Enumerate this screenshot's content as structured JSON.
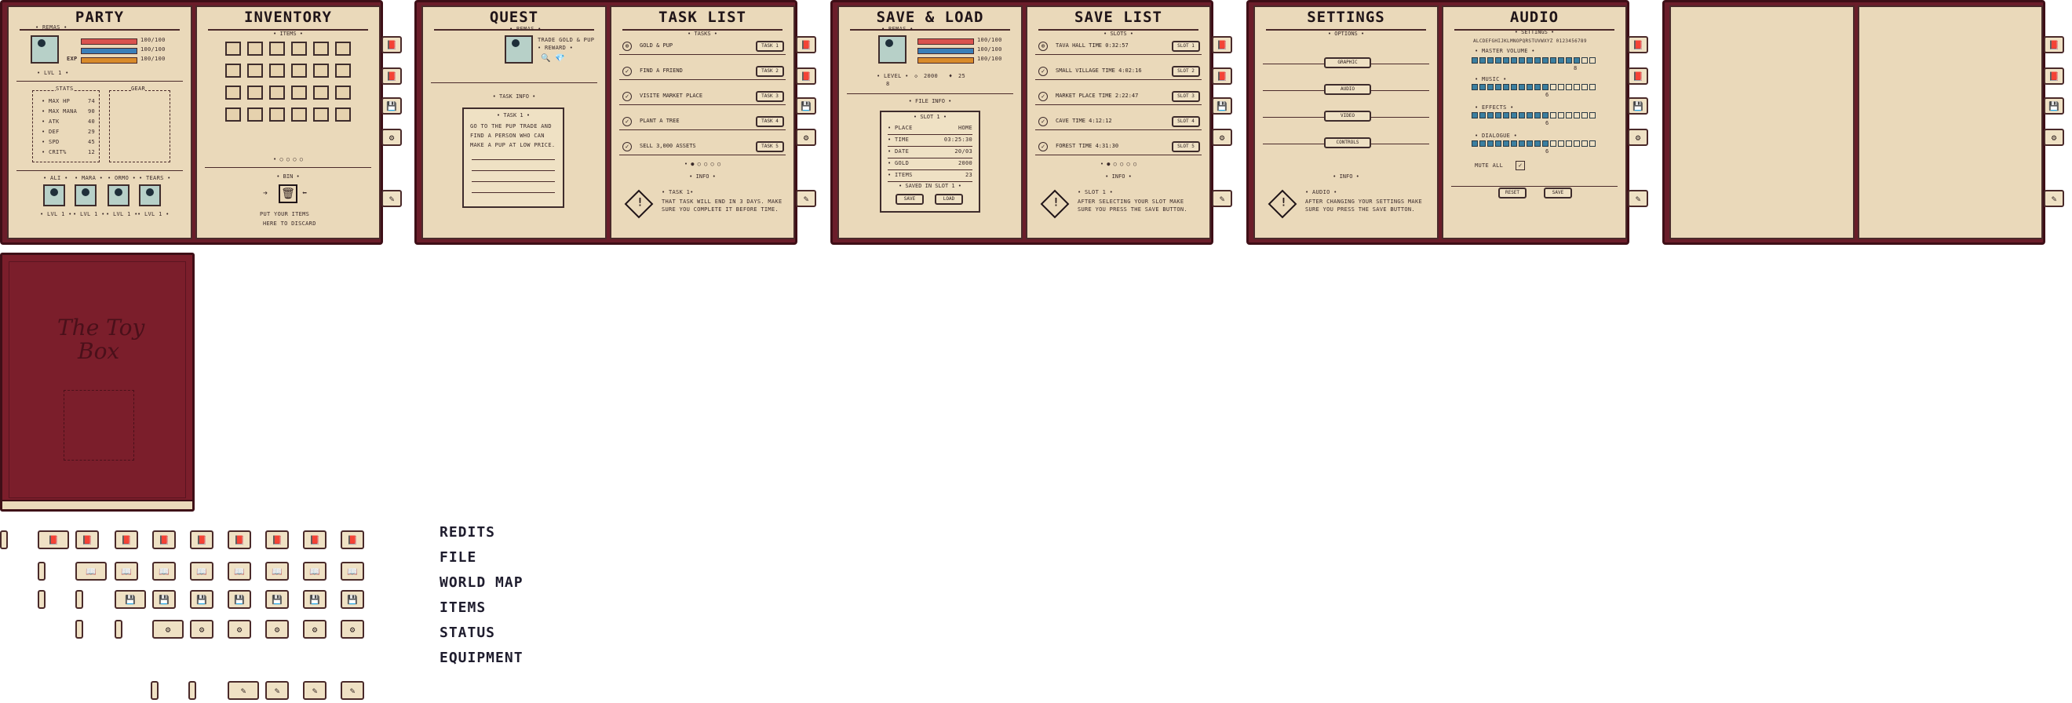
{
  "books": {
    "party": {
      "title": "PARTY",
      "hero_name": "• REMAS •",
      "hp_text": "100/100",
      "mp_text": "100/100",
      "exp_label": "EXP",
      "exp_text": "100/100",
      "level": "• LVL 1 •",
      "stats_header": "STATS",
      "gear_header": "GEAR",
      "stats": [
        {
          "k": "• MAX HP",
          "v": "74"
        },
        {
          "k": "• MAX MANA",
          "v": "90"
        },
        {
          "k": "• ATK",
          "v": "40"
        },
        {
          "k": "• DEF",
          "v": "29"
        },
        {
          "k": "• SPD",
          "v": "45"
        },
        {
          "k": "• CRIT%",
          "v": "12"
        }
      ],
      "members": [
        "• ALI •",
        "• MARA •",
        "• ORMO •",
        "• TEARS •"
      ],
      "member_levels": [
        "• LVL 1 •",
        "• LVL 1 •",
        "• LVL 1 •",
        "• LVL 1 •"
      ]
    },
    "inventory": {
      "title": "INVENTORY",
      "items_header": "• ITEMS •",
      "bin_header": "• BIN •",
      "bin_hint_1": "PUT YOUR ITEMS",
      "bin_hint_2": "HERE TO DISCARD",
      "dots": "• ○ ○ ○ ○"
    },
    "quest": {
      "title": "QUEST",
      "hero_name": "• REMAS •",
      "goal": "TRADE GOLD & PUP",
      "reward_label": "• REWARD •",
      "task_info_header": "• TASK INFO •",
      "task_num": "• TASK 1 •",
      "task_lines": [
        "GO TO THE PUP TRADE AND",
        "FIND A PERSON WHO CAN",
        "MAKE A PUP AT LOW PRICE."
      ]
    },
    "task_list": {
      "title": "TASK LIST",
      "header": "• TASKS •",
      "tasks": [
        {
          "text": "GOLD & PUP",
          "btn": "TASK 1"
        },
        {
          "text": "FIND A FRIEND",
          "btn": "TASK 2"
        },
        {
          "text": "VISITE MARKET PLACE",
          "btn": "TASK 3"
        },
        {
          "text": "PLANT A TREE",
          "btn": "TASK 4"
        },
        {
          "text": "SELL 3,000 ASSETS",
          "btn": "TASK 5"
        }
      ],
      "dots": "• ● ○ ○ ○ ○",
      "info_header": "• INFO •",
      "info_title": "• TASK 1•",
      "info_lines": [
        "THAT TASK WILL END IN 3 DAYS. MAKE",
        "SURE YOU COMPLETE IT BEFORE TIME."
      ]
    },
    "save_load": {
      "title": "SAVE & LOAD",
      "hero_name": "• REMAS •",
      "hp_text": "100/100",
      "mp_text": "100/100",
      "exp_text": "100/100",
      "level_label": "• LEVEL •",
      "gold": "2000",
      "gems": "25",
      "level": "8",
      "file_info_header": "• FILE INFO •",
      "slot_header": "• SLOT 1 •",
      "fields": [
        {
          "k": "• PLACE",
          "v": "HOME"
        },
        {
          "k": "• TIME",
          "v": "03:25:30"
        },
        {
          "k": "• DATE",
          "v": "20/03"
        },
        {
          "k": "• GOLD",
          "v": "2000"
        },
        {
          "k": "• ITEMS",
          "v": "23"
        }
      ],
      "saved_label": "• SAVED IN SLOT 1 •",
      "save_btn": "SAVE",
      "load_btn": "LOAD"
    },
    "save_list": {
      "title": "SAVE LIST",
      "header": "• SLOTS •",
      "slots": [
        {
          "text": "TAVA HALL TIME 0:32:57",
          "btn": "SLOT 1"
        },
        {
          "text": "SMALL VILLAGE TIME 4:02:16",
          "btn": "SLOT 2"
        },
        {
          "text": "MARKET PLACE TIME 2:22:47",
          "btn": "SLOT 3"
        },
        {
          "text": "CAVE TIME 4:12:12",
          "btn": "SLOT 4"
        },
        {
          "text": "FOREST TIME 4:31:30",
          "btn": "SLOT 5"
        }
      ],
      "dots": "• ● ○ ○ ○ ○",
      "info_header": "• INFO •",
      "info_title": "• SLOT 1 •",
      "info_lines": [
        "AFTER SELECTING YOUR SLOT MAKE",
        "SURE YOU PRESS THE SAVE BUTTON."
      ]
    },
    "settings": {
      "title": "SETTINGS",
      "header": "• OPTIONS •",
      "options": [
        "GRAPHIC",
        "AUDIO",
        "VIDEO",
        "CONTROLS"
      ],
      "info_header": "• INFO •",
      "info_title": "• AUDIO •",
      "info_lines": [
        "AFTER CHANGING YOUR SETTINGS MAKE",
        "SURE YOU PRESS THE SAVE BUTTON."
      ]
    },
    "audio": {
      "title": "AUDIO",
      "header": "• SETTINGS •",
      "scale": "ALCDEFGHIJKLMNOPQRSTUVWXYZ 0123456789",
      "sliders": [
        {
          "label": "• MASTER VOLUME •",
          "level": 0.85,
          "value": "8"
        },
        {
          "label": "• MUSIC •",
          "level": 0.6,
          "value": "6"
        },
        {
          "label": "• EFFECTS •",
          "level": 0.6,
          "value": "6"
        },
        {
          "label": "• DIALOGUE •",
          "level": 0.6,
          "value": "6"
        }
      ],
      "mute_label": "MUTE ALL",
      "reset_btn": "RESET",
      "save_btn": "SAVE"
    }
  },
  "cover": {
    "title_line1": "The Toy",
    "title_line2": "Box"
  },
  "legend": [
    "REDITS",
    "FILE",
    "WORLD MAP",
    "ITEMS",
    "STATUS",
    "EQUIPMENT"
  ],
  "colors": {
    "cover": "#7b1e2b",
    "page": "#ead9ba",
    "hp": "#d9534f",
    "mp": "#3b7fb8",
    "exp": "#d98b2b",
    "slider": "#3b7fa0"
  }
}
